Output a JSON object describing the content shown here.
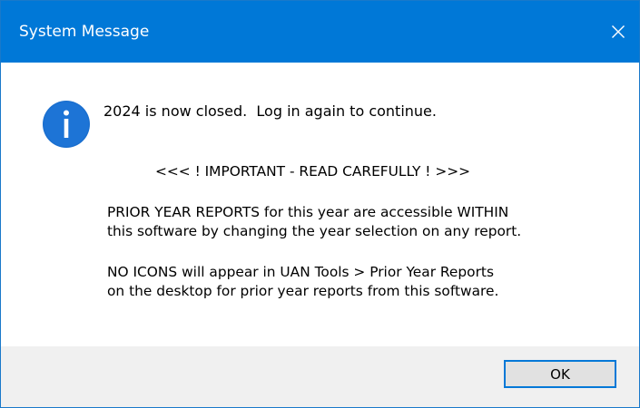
{
  "window": {
    "title": "System Message",
    "accent_color": "#0078d7"
  },
  "icons": {
    "close": "close-icon",
    "message": "info-icon"
  },
  "message": {
    "main": "2024 is now closed.  Log in again to continue.",
    "important": "<<< ! IMPORTANT - READ CAREFULLY ! >>>",
    "paragraph1": [
      "PRIOR YEAR REPORTS for this year are accessible WITHIN",
      "this software by changing the year selection on any report."
    ],
    "paragraph2": [
      "NO ICONS will appear in UAN Tools > Prior Year Reports",
      "on the desktop for prior year reports from this software."
    ]
  },
  "buttons": {
    "ok_label": "OK"
  }
}
